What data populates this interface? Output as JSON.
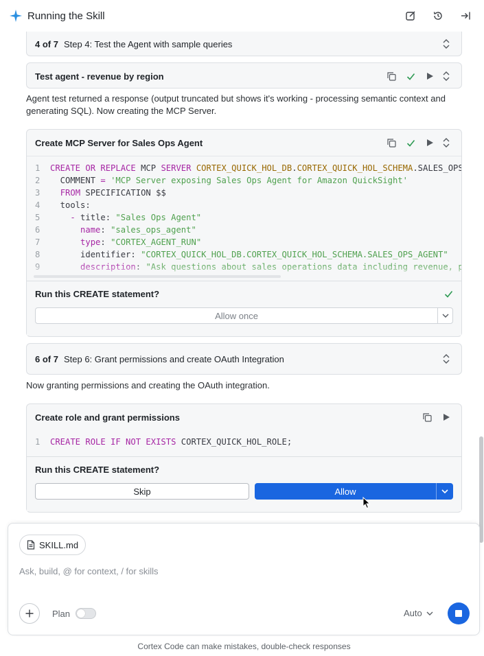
{
  "header": {
    "title": "Running the Skill",
    "icons": [
      "sparkle-icon",
      "edit-icon",
      "history-icon",
      "collapse-panel-icon"
    ]
  },
  "step4": {
    "counter": "4 of 7",
    "label": "Step 4: Test the Agent with sample queries"
  },
  "test_agent": {
    "title": "Test agent - revenue by region"
  },
  "para1": "Agent test returned a response (output truncated but shows it's working - processing semantic context and generating SQL). Now creating the MCP Server.",
  "mcp_card": {
    "title": "Create MCP Server for Sales Ops Agent",
    "code_lines": [
      {
        "n": "1",
        "parts": [
          [
            "kw",
            "CREATE OR REPLACE"
          ],
          [
            "pl",
            " MCP "
          ],
          [
            "kw",
            "SERVER"
          ],
          [
            "pl",
            " "
          ],
          [
            "id",
            "CORTEX_QUICK_HOL_DB"
          ],
          [
            "pl",
            "."
          ],
          [
            "id",
            "CORTEX_QUICK_HOL_SCHEMA"
          ],
          [
            "pl",
            ".SALES_OPS_"
          ]
        ]
      },
      {
        "n": "2",
        "parts": [
          [
            "pl",
            "  COMMENT "
          ],
          [
            "kw",
            "="
          ],
          [
            "pl",
            " "
          ],
          [
            "str",
            "'MCP Server exposing Sales Ops Agent for Amazon QuickSight'"
          ]
        ]
      },
      {
        "n": "3",
        "parts": [
          [
            "pl",
            "  "
          ],
          [
            "kw",
            "FROM"
          ],
          [
            "pl",
            " SPECIFICATION $$"
          ]
        ]
      },
      {
        "n": "4",
        "parts": [
          [
            "pl",
            "  tools:"
          ]
        ]
      },
      {
        "n": "5",
        "parts": [
          [
            "pl",
            "    "
          ],
          [
            "kw",
            "-"
          ],
          [
            "pl",
            " title: "
          ],
          [
            "str",
            "\"Sales Ops Agent\""
          ]
        ]
      },
      {
        "n": "6",
        "parts": [
          [
            "pl",
            "      "
          ],
          [
            "kw",
            "name"
          ],
          [
            "pl",
            ": "
          ],
          [
            "str",
            "\"sales_ops_agent\""
          ]
        ]
      },
      {
        "n": "7",
        "parts": [
          [
            "pl",
            "      "
          ],
          [
            "kw",
            "type"
          ],
          [
            "pl",
            ": "
          ],
          [
            "str",
            "\"CORTEX_AGENT_RUN\""
          ]
        ]
      },
      {
        "n": "8",
        "parts": [
          [
            "pl",
            "      identifier: "
          ],
          [
            "str",
            "\"CORTEX_QUICK_HOL_DB.CORTEX_QUICK_HOL_SCHEMA.SALES_OPS_AGENT\""
          ]
        ]
      },
      {
        "n": "9",
        "parts": [
          [
            "pl",
            "      "
          ],
          [
            "kw",
            "description"
          ],
          [
            "pl",
            ": "
          ],
          [
            "str",
            "\"Ask questions about sales operations data including revenue, pi"
          ]
        ]
      }
    ],
    "confirm_question": "Run this CREATE statement?",
    "allow_once": "Allow once"
  },
  "step6": {
    "counter": "6 of 7",
    "label": "Step 6: Grant permissions and create OAuth Integration"
  },
  "para2": "Now granting permissions and creating the OAuth integration.",
  "role_card": {
    "title": "Create role and grant permissions",
    "code_lines": [
      {
        "n": "1",
        "parts": [
          [
            "kw",
            "CREATE ROLE IF NOT EXISTS"
          ],
          [
            "pl",
            " CORTEX_QUICK_HOL_ROLE;"
          ]
        ]
      }
    ],
    "confirm_question": "Run this CREATE statement?",
    "skip": "Skip",
    "allow": "Allow"
  },
  "composer": {
    "file_chip": "SKILL.md",
    "placeholder": "Ask, build, @ for context, / for skills",
    "plan_label": "Plan",
    "plan_enabled": false,
    "mode": "Auto"
  },
  "disclaimer": "Cortex Code can make mistakes, double-check responses",
  "colors": {
    "accent": "#1a66e0",
    "success": "#2e9a53",
    "keyword": "#a626a4",
    "string": "#50a14f",
    "identifier": "#986801"
  }
}
